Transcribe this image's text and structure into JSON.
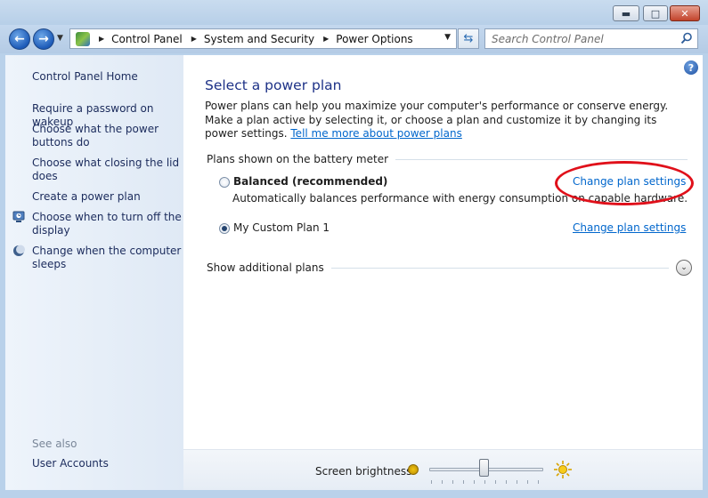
{
  "window": {
    "minimize_glyph": "▬",
    "maximize_glyph": "□",
    "close_glyph": "✕"
  },
  "navigation": {
    "back_glyph": "←",
    "forward_glyph": "→",
    "breadcrumbs": [
      "Control Panel",
      "System and Security",
      "Power Options"
    ],
    "search_placeholder": "Search Control Panel"
  },
  "sidebar": {
    "home": "Control Panel Home",
    "links": [
      "Require a password on wakeup",
      "Choose what the power buttons do",
      "Choose what closing the lid does",
      "Create a power plan",
      "Choose when to turn off the display",
      "Change when the computer sleeps"
    ],
    "link_icons": [
      "",
      "",
      "",
      "",
      "display-icon",
      "sleep-moon-icon"
    ],
    "see_also": "See also",
    "see_also_links": [
      "User Accounts"
    ]
  },
  "main": {
    "help_glyph": "?",
    "title": "Select a power plan",
    "intro_text": "Power plans can help you maximize your computer's performance or conserve energy. Make a plan active by selecting it, or choose a plan and customize it by changing its power settings. ",
    "intro_link": "Tell me more about power plans",
    "group_label": "Plans shown on the battery meter",
    "plans": [
      {
        "name": "Balanced (recommended)",
        "description": "Automatically balances performance with energy consumption on capable hardware.",
        "selected": false,
        "change_link": "Change plan settings"
      },
      {
        "name": "My Custom Plan 1",
        "description": "",
        "selected": true,
        "change_link": "Change plan settings"
      }
    ],
    "additional_label": "Show additional plans",
    "expand_glyph": "⌄"
  },
  "bottom": {
    "brightness_label": "Screen brightness:",
    "brightness_level": 0.48
  },
  "colors": {
    "link": "#0066cc",
    "title": "#1e3287",
    "annotation": "#e0101a"
  }
}
